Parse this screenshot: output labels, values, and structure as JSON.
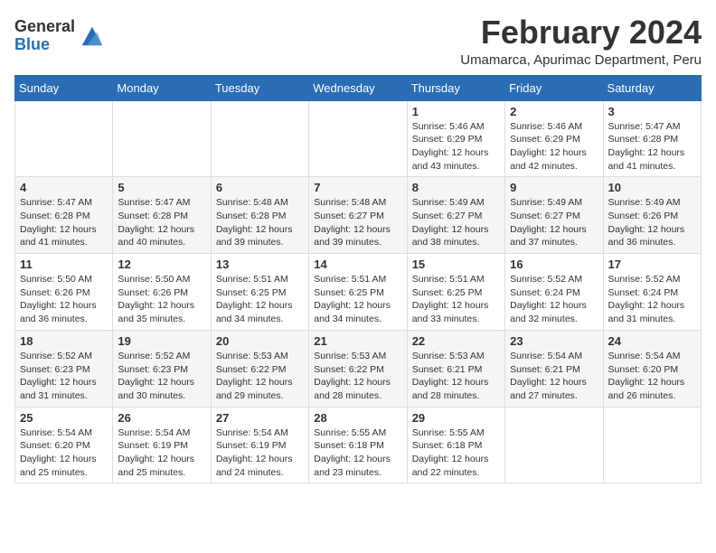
{
  "logo": {
    "general": "General",
    "blue": "Blue"
  },
  "title": "February 2024",
  "subtitle": "Umamarca, Apurimac Department, Peru",
  "days_of_week": [
    "Sunday",
    "Monday",
    "Tuesday",
    "Wednesday",
    "Thursday",
    "Friday",
    "Saturday"
  ],
  "weeks": [
    [
      {
        "day": "",
        "info": ""
      },
      {
        "day": "",
        "info": ""
      },
      {
        "day": "",
        "info": ""
      },
      {
        "day": "",
        "info": ""
      },
      {
        "day": "1",
        "info": "Sunrise: 5:46 AM\nSunset: 6:29 PM\nDaylight: 12 hours and 43 minutes."
      },
      {
        "day": "2",
        "info": "Sunrise: 5:46 AM\nSunset: 6:29 PM\nDaylight: 12 hours and 42 minutes."
      },
      {
        "day": "3",
        "info": "Sunrise: 5:47 AM\nSunset: 6:28 PM\nDaylight: 12 hours and 41 minutes."
      }
    ],
    [
      {
        "day": "4",
        "info": "Sunrise: 5:47 AM\nSunset: 6:28 PM\nDaylight: 12 hours and 41 minutes."
      },
      {
        "day": "5",
        "info": "Sunrise: 5:47 AM\nSunset: 6:28 PM\nDaylight: 12 hours and 40 minutes."
      },
      {
        "day": "6",
        "info": "Sunrise: 5:48 AM\nSunset: 6:28 PM\nDaylight: 12 hours and 39 minutes."
      },
      {
        "day": "7",
        "info": "Sunrise: 5:48 AM\nSunset: 6:27 PM\nDaylight: 12 hours and 39 minutes."
      },
      {
        "day": "8",
        "info": "Sunrise: 5:49 AM\nSunset: 6:27 PM\nDaylight: 12 hours and 38 minutes."
      },
      {
        "day": "9",
        "info": "Sunrise: 5:49 AM\nSunset: 6:27 PM\nDaylight: 12 hours and 37 minutes."
      },
      {
        "day": "10",
        "info": "Sunrise: 5:49 AM\nSunset: 6:26 PM\nDaylight: 12 hours and 36 minutes."
      }
    ],
    [
      {
        "day": "11",
        "info": "Sunrise: 5:50 AM\nSunset: 6:26 PM\nDaylight: 12 hours and 36 minutes."
      },
      {
        "day": "12",
        "info": "Sunrise: 5:50 AM\nSunset: 6:26 PM\nDaylight: 12 hours and 35 minutes."
      },
      {
        "day": "13",
        "info": "Sunrise: 5:51 AM\nSunset: 6:25 PM\nDaylight: 12 hours and 34 minutes."
      },
      {
        "day": "14",
        "info": "Sunrise: 5:51 AM\nSunset: 6:25 PM\nDaylight: 12 hours and 34 minutes."
      },
      {
        "day": "15",
        "info": "Sunrise: 5:51 AM\nSunset: 6:25 PM\nDaylight: 12 hours and 33 minutes."
      },
      {
        "day": "16",
        "info": "Sunrise: 5:52 AM\nSunset: 6:24 PM\nDaylight: 12 hours and 32 minutes."
      },
      {
        "day": "17",
        "info": "Sunrise: 5:52 AM\nSunset: 6:24 PM\nDaylight: 12 hours and 31 minutes."
      }
    ],
    [
      {
        "day": "18",
        "info": "Sunrise: 5:52 AM\nSunset: 6:23 PM\nDaylight: 12 hours and 31 minutes."
      },
      {
        "day": "19",
        "info": "Sunrise: 5:52 AM\nSunset: 6:23 PM\nDaylight: 12 hours and 30 minutes."
      },
      {
        "day": "20",
        "info": "Sunrise: 5:53 AM\nSunset: 6:22 PM\nDaylight: 12 hours and 29 minutes."
      },
      {
        "day": "21",
        "info": "Sunrise: 5:53 AM\nSunset: 6:22 PM\nDaylight: 12 hours and 28 minutes."
      },
      {
        "day": "22",
        "info": "Sunrise: 5:53 AM\nSunset: 6:21 PM\nDaylight: 12 hours and 28 minutes."
      },
      {
        "day": "23",
        "info": "Sunrise: 5:54 AM\nSunset: 6:21 PM\nDaylight: 12 hours and 27 minutes."
      },
      {
        "day": "24",
        "info": "Sunrise: 5:54 AM\nSunset: 6:20 PM\nDaylight: 12 hours and 26 minutes."
      }
    ],
    [
      {
        "day": "25",
        "info": "Sunrise: 5:54 AM\nSunset: 6:20 PM\nDaylight: 12 hours and 25 minutes."
      },
      {
        "day": "26",
        "info": "Sunrise: 5:54 AM\nSunset: 6:19 PM\nDaylight: 12 hours and 25 minutes."
      },
      {
        "day": "27",
        "info": "Sunrise: 5:54 AM\nSunset: 6:19 PM\nDaylight: 12 hours and 24 minutes."
      },
      {
        "day": "28",
        "info": "Sunrise: 5:55 AM\nSunset: 6:18 PM\nDaylight: 12 hours and 23 minutes."
      },
      {
        "day": "29",
        "info": "Sunrise: 5:55 AM\nSunset: 6:18 PM\nDaylight: 12 hours and 22 minutes."
      },
      {
        "day": "",
        "info": ""
      },
      {
        "day": "",
        "info": ""
      }
    ]
  ]
}
